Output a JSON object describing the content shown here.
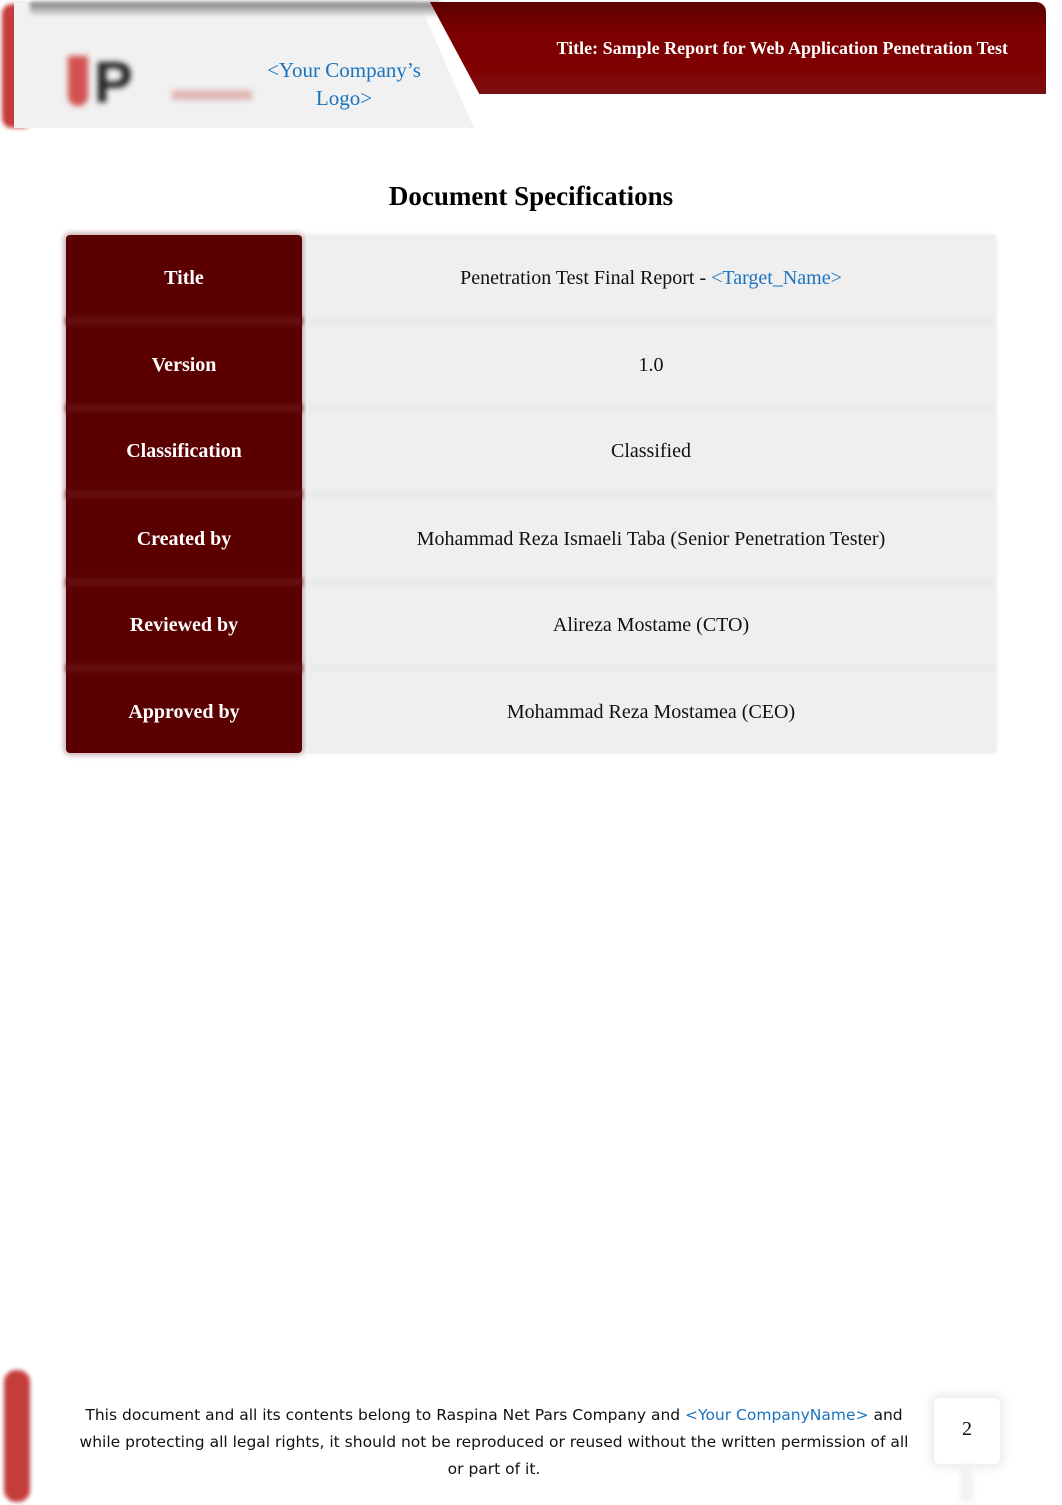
{
  "header": {
    "logo_placeholder": "<Your Company’s Logo>",
    "logo_mark": "P",
    "title": "Title: Sample Report for Web Application Penetration Test",
    "accent_color": "#800000"
  },
  "page": {
    "heading": "Document Specifications"
  },
  "specs": [
    {
      "label": "Title",
      "value": "Penetration Test Final Report - ",
      "value_placeholder": "<Target_Name>"
    },
    {
      "label": "Version",
      "value": "1.0"
    },
    {
      "label": "Classification",
      "value": "Classified"
    },
    {
      "label": "Created by",
      "value": "Mohammad Reza Ismaeli Taba (Senior Penetration Tester)"
    },
    {
      "label": "Reviewed by",
      "value": "Alireza Mostame (CTO)"
    },
    {
      "label": "Approved by",
      "value": "Mohammad Reza Mostamea (CEO)"
    }
  ],
  "footer": {
    "text_before": "This document and all its contents belong to Raspina Net Pars Company and ",
    "company_placeholder": "<Your CompanyName>",
    "text_after": " and while protecting all legal rights, it should not be reproduced or reused without the written permission of all or part of it.",
    "page_number": "2"
  }
}
